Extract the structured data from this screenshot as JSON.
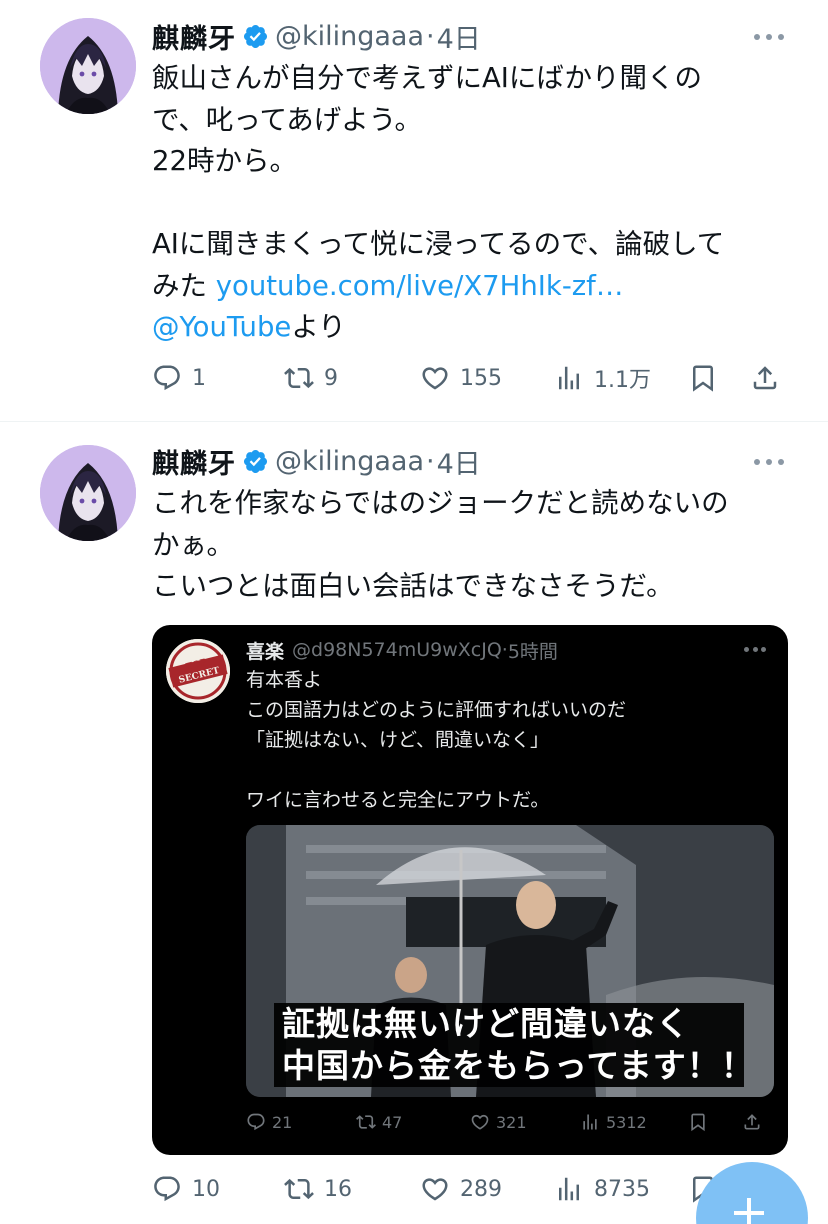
{
  "tweets": [
    {
      "author_name": "麒麟牙",
      "handle": "@kilingaaa",
      "separator": "·",
      "time": "4日",
      "lines": [
        "飯山さんが自分で考えずにAIにばかり聞くの",
        "で、叱ってあげよう。",
        "22時から。",
        "",
        "AIに聞きまくって悦に浸ってるので、論破して"
      ],
      "line6_prefix": "みた ",
      "line6_link": "youtube.com/live/X7HhIk-zf…",
      "line7_link": "@YouTube",
      "line7_suffix": "より",
      "actions": {
        "reply": "1",
        "repost": "9",
        "like": "155",
        "views": "1.1万"
      }
    },
    {
      "author_name": "麒麟牙",
      "handle": "@kilingaaa",
      "separator": "·",
      "time": "4日",
      "lines": [
        "これを作家ならではのジョークだと読めないの",
        "かぁ。",
        "こいつとは面白い会話はできなさそうだ。"
      ],
      "actions": {
        "reply": "10",
        "repost": "16",
        "like": "289",
        "views": "8735"
      },
      "quote": {
        "author_name": "喜楽",
        "handle": "@d98N574mU9wXcJQ",
        "separator": "·",
        "time": "5時間",
        "avatar_text": [
          "TOP",
          "SECRET"
        ],
        "lines": [
          "有本香よ",
          "この国語力はどのように評価すればいいのだ",
          "「証拠はない、けど、間違いなく」",
          "",
          "ワイに言わせると完全にアウトだ。"
        ],
        "subtitle": [
          "証拠は無いけど間違いなく",
          "中国から金をもらってます！！"
        ],
        "actions": {
          "reply": "21",
          "repost": "47",
          "like": "321",
          "views": "5312"
        }
      }
    }
  ],
  "colors": {
    "link": "#1d9bf0",
    "muted": "#536471",
    "verified": "#1d9bf0",
    "fab": "#7fc1f5"
  }
}
